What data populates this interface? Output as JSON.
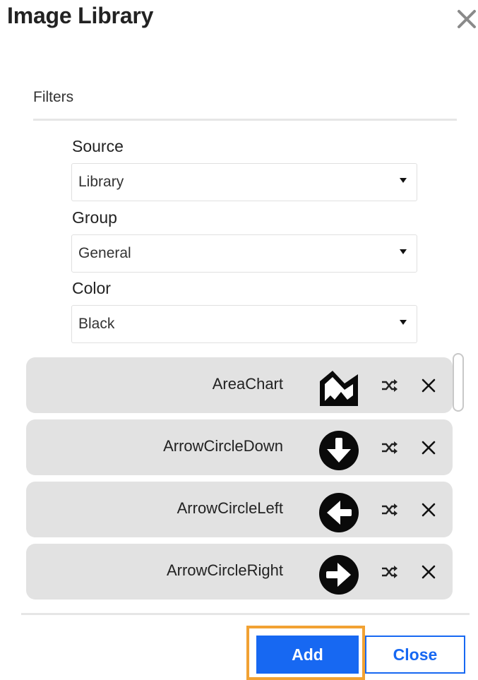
{
  "dialog": {
    "title": "Image Library",
    "close_icon": "close-icon"
  },
  "filters": {
    "label": "Filters",
    "source": {
      "label": "Source",
      "value": "Library"
    },
    "group": {
      "label": "Group",
      "value": "General"
    },
    "color": {
      "label": "Color",
      "value": "Black"
    }
  },
  "images": [
    {
      "name": "AreaChart",
      "icon": "area-chart-icon"
    },
    {
      "name": "ArrowCircleDown",
      "icon": "arrow-circle-down-icon"
    },
    {
      "name": "ArrowCircleLeft",
      "icon": "arrow-circle-left-icon"
    },
    {
      "name": "ArrowCircleRight",
      "icon": "arrow-circle-right-icon"
    }
  ],
  "row_actions": {
    "shuffle_icon": "shuffle-icon",
    "remove_icon": "remove-icon"
  },
  "footer": {
    "add_label": "Add",
    "close_label": "Close"
  },
  "colors": {
    "primary": "#1768f2",
    "focus": "#f2a233",
    "row_bg": "#e2e2e2"
  }
}
